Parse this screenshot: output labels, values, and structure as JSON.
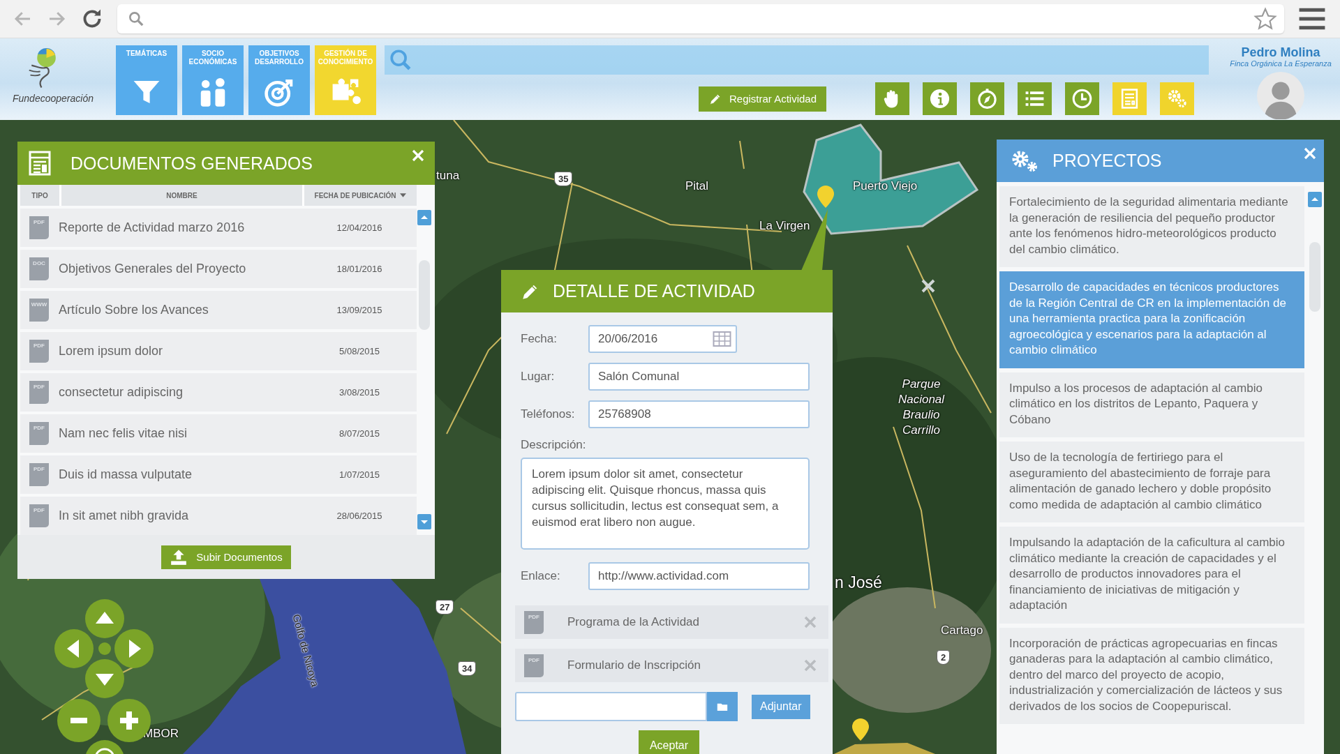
{
  "header": {
    "logo_text": "Fundecooperación",
    "categories": [
      {
        "label": "TEMÁTICAS",
        "kind": "filter",
        "selected": false
      },
      {
        "label": "SOCIO ECONÓMICAS",
        "kind": "people",
        "selected": false
      },
      {
        "label": "OBJETIVOS DESARROLLO",
        "kind": "target",
        "selected": false
      },
      {
        "label": "GESTIÓN DE CONOCIMIENTO",
        "kind": "puzzle",
        "selected": true
      }
    ],
    "register_button": "Registrar Actividad",
    "tools": [
      {
        "kind": "hand",
        "color": "#7ba428"
      },
      {
        "kind": "info",
        "color": "#7ba428"
      },
      {
        "kind": "compass",
        "color": "#7ba428"
      },
      {
        "kind": "list",
        "color": "#7ba428"
      },
      {
        "kind": "clock",
        "color": "#7ba428"
      },
      {
        "kind": "document",
        "color": "#f0d42c"
      },
      {
        "kind": "settings",
        "color": "#f0d42c"
      }
    ],
    "user": {
      "name": "Pedro Molina",
      "organization": "Finca Orgánica La Esperanza"
    }
  },
  "map": {
    "labels": [
      {
        "text": "tuna",
        "kind": "place"
      },
      {
        "text": "Pital",
        "kind": "place"
      },
      {
        "text": "Puerto Viejo",
        "kind": "place"
      },
      {
        "text": "La Virgen",
        "kind": "place"
      },
      {
        "text": "Parque Nacional Braulio Carrillo",
        "kind": "park"
      },
      {
        "text": "n José",
        "kind": "city"
      },
      {
        "text": "Cartago",
        "kind": "place"
      },
      {
        "text": "Golfo de Nicoya",
        "kind": "water"
      },
      {
        "text": "MBOR",
        "kind": "place"
      }
    ],
    "route_shields": [
      "35",
      "27",
      "34",
      "2"
    ]
  },
  "documents_panel": {
    "title": "DOCUMENTOS GENERADOS",
    "columns": [
      {
        "label": "TIPO",
        "sorted": false
      },
      {
        "label": "NOMBRE",
        "sorted": false
      },
      {
        "label": "FECHA DE PUBICACIÓN",
        "sorted": true
      }
    ],
    "rows": [
      {
        "type": "PDF",
        "name": "Reporte de Actividad marzo 2016",
        "date": "12/04/2016"
      },
      {
        "type": "DOC",
        "name": "Objetivos Generales del Proyecto",
        "date": "18/01/2016"
      },
      {
        "type": "WWW",
        "name": "Artículo Sobre los Avances",
        "date": "13/09/2015"
      },
      {
        "type": "PDF",
        "name": "Lorem ipsum dolor",
        "date": "5/08/2015"
      },
      {
        "type": "PDF",
        "name": "consectetur adipiscing",
        "date": "3/08/2015"
      },
      {
        "type": "PDF",
        "name": "Nam nec felis vitae nisi",
        "date": "8/07/2015"
      },
      {
        "type": "PDF",
        "name": "Duis id massa vulputate",
        "date": "1/07/2015"
      },
      {
        "type": "PDF",
        "name": "In sit amet nibh gravida",
        "date": "28/06/2015"
      }
    ],
    "upload_button": "Subir Documentos"
  },
  "activity_panel": {
    "title": "DETALLE DE ACTIVIDAD",
    "fields": [
      {
        "label": "Fecha:",
        "value": "20/06/2016",
        "kind": "date"
      },
      {
        "label": "Lugar:",
        "value": "Salón Comunal",
        "kind": "text"
      },
      {
        "label": "Teléfonos:",
        "value": "25768908",
        "kind": "text"
      },
      {
        "label": "Descripción:",
        "value": "Lorem ipsum dolor sit amet, consectetur adipiscing elit. Quisque rhoncus, massa quis cursus sollicitudin, lectus est consequat sem, a euismod erat libero non augue.",
        "kind": "textarea"
      },
      {
        "label": "Enlace:",
        "value": "http://www.actividad.com",
        "kind": "text"
      }
    ],
    "attachments": [
      {
        "type": "PDF",
        "name": "Programa de la Actividad"
      },
      {
        "type": "PDF",
        "name": "Formulario de Inscripción"
      }
    ],
    "attach_button": "Adjuntar",
    "accept_button": "Aceptar"
  },
  "projects_panel": {
    "title": "PROYECTOS",
    "items": [
      {
        "text": "Fortalecimiento de la seguridad alimentaria mediante la generación de resiliencia del pequeño productor ante los fenómenos hidro-meteorológicos producto del cambio climático.",
        "selected": false
      },
      {
        "text": "Desarrollo de capacidades en técnicos productores de la Región Central de CR en la implementación de una herramienta practica para la zonificación agroecológica y escenarios para la adaptación al cambio climático",
        "selected": true
      },
      {
        "text": "Impulso a los procesos de adaptación al cambio climático en los distritos de Lepanto, Paquera y Cóbano",
        "selected": false
      },
      {
        "text": "Uso de la tecnología de fertiriego para el aseguramiento del abastecimiento de forraje para alimentación de ganado lechero y doble propósito como medida de adaptación al cambio climático",
        "selected": false
      },
      {
        "text": "Impulsando la adaptación de la caficultura al cambio climático mediante la creación de capacidades y el desarrollo de productos innovadores para el financiamiento de iniciativas de mitigación y adaptación",
        "selected": false
      },
      {
        "text": "Incorporación de prácticas agropecuarias en fincas ganaderas para la adaptación al cambio climático, dentro del marco del proyecto de acopio, industrialización y comercialización de lácteos y sus derivados de los socios de Coopepuriscal.",
        "selected": false
      }
    ]
  }
}
